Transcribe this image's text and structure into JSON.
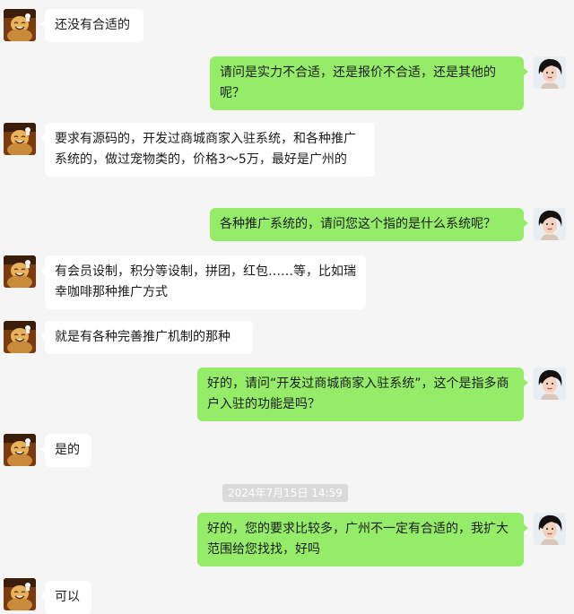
{
  "chat": {
    "messages": [
      {
        "side": "in",
        "text": "还没有合适的"
      },
      {
        "side": "out",
        "text": "请问是实力不合适，还是报价不合适，还是其他的呢？"
      },
      {
        "side": "in",
        "text": "要求有源码的，开发过商城商家入驻系统，和各种推广系统的，做过宠物类的，价格3～5万，最好是广州的"
      },
      {
        "side": "out",
        "text": "各种推广系统的，请问您这个指的是什么系统呢？"
      },
      {
        "side": "in",
        "text": "有会员设制，积分等设制，拼团，红包……等，比如瑞幸咖啡那种推广方式"
      },
      {
        "side": "in",
        "text": "就是有各种完善推广机制的那种"
      },
      {
        "side": "out",
        "text": "好的，请问“开发过商城商家入驻系统”，这个是指多商户入驻的功能是吗？"
      },
      {
        "side": "in",
        "text": "是的"
      },
      {
        "side": "out",
        "text": "好的，您的要求比较多，广州不一定有合适的，我扩大范围给您找找，好吗"
      },
      {
        "side": "in",
        "text": "可以"
      }
    ],
    "timestamp": "2024年7月15日 14:59"
  },
  "colors": {
    "background": "#f5f5f5",
    "incoming_bubble": "#ffffff",
    "outgoing_bubble": "#95ec69",
    "timestamp_bg": "#dadada"
  },
  "icons": {
    "incoming_avatar": "laughing-buddha-avatar-icon",
    "outgoing_avatar": "woman-portrait-avatar-icon"
  }
}
